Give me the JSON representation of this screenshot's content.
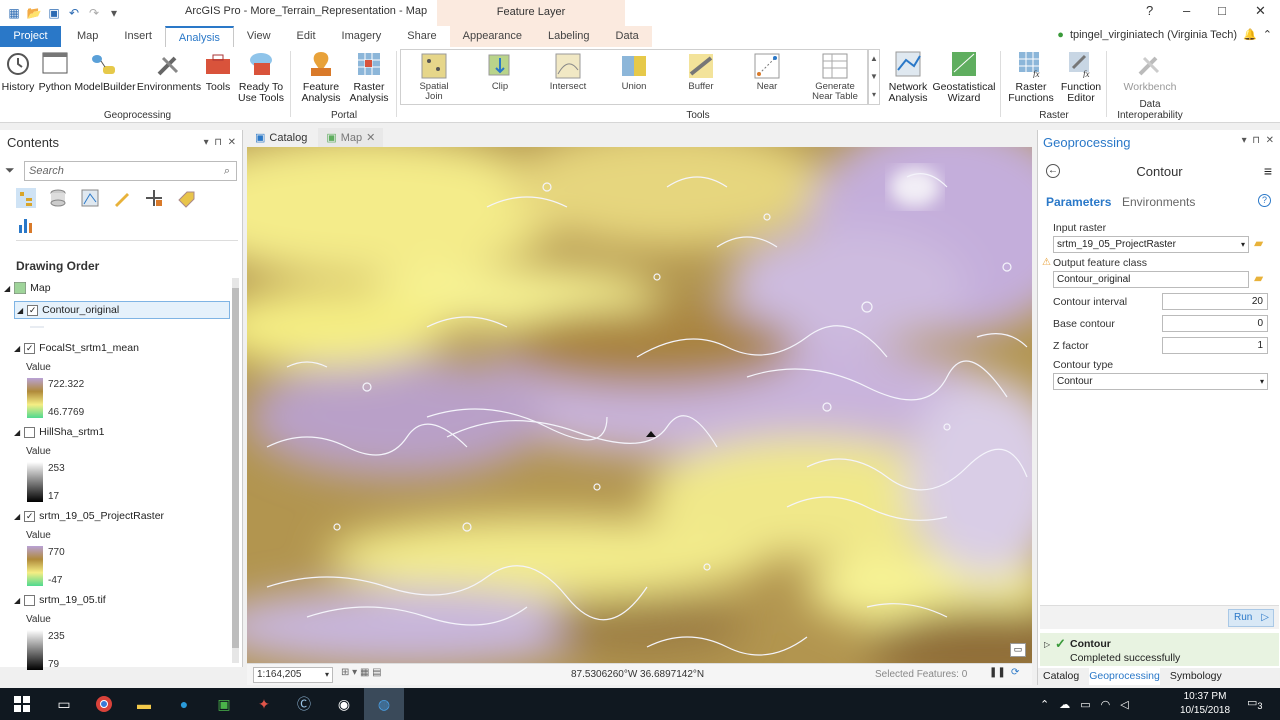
{
  "window": {
    "title": "ArcGIS Pro - More_Terrain_Representation - Map",
    "context_tab": "Feature Layer",
    "help": "?",
    "minimize": "–",
    "maximize": "□",
    "close": "✕"
  },
  "user": {
    "name": "tpingel_virginiatech (Virginia Tech)"
  },
  "tabs": [
    "Project",
    "Map",
    "Insert",
    "Analysis",
    "View",
    "Edit",
    "Imagery",
    "Share",
    "Appearance",
    "Labeling",
    "Data"
  ],
  "ribbon": {
    "geoprocessing": {
      "label": "Geoprocessing",
      "buttons": [
        "History",
        "Python",
        "ModelBuilder",
        "Environments",
        "Tools"
      ],
      "ready_line1": "Ready To",
      "ready_line2": "Use Tools"
    },
    "portal": {
      "label": "Portal",
      "feature_line1": "Feature",
      "feature_line2": "Analysis",
      "raster_line1": "Raster",
      "raster_line2": "Analysis"
    },
    "tools": {
      "label": "Tools",
      "items": [
        {
          "l1": "Spatial",
          "l2": "Join"
        },
        {
          "l1": "Clip",
          "l2": ""
        },
        {
          "l1": "Intersect",
          "l2": ""
        },
        {
          "l1": "Union",
          "l2": ""
        },
        {
          "l1": "Buffer",
          "l2": ""
        },
        {
          "l1": "Near",
          "l2": ""
        },
        {
          "l1": "Generate",
          "l2": "Near Table"
        }
      ],
      "network_line1": "Network",
      "network_line2": "Analysis",
      "geostat_line1": "Geostatistical",
      "geostat_line2": "Wizard"
    },
    "raster": {
      "label": "Raster",
      "rf_line1": "Raster",
      "rf_line2": "Functions",
      "fe_line1": "Function",
      "fe_line2": "Editor"
    },
    "interop": {
      "label": "Data Interoperability",
      "workbench": "Workbench"
    }
  },
  "contents": {
    "title": "Contents",
    "search_placeholder": "Search",
    "drawing_order": "Drawing Order",
    "map_label": "Map",
    "layers": [
      {
        "name": "Contour_original",
        "checked": "✓"
      },
      {
        "name": "FocalSt_srtm1_mean",
        "checked": "✓",
        "value_label": "Value",
        "max": "722.322",
        "min": "46.7769"
      },
      {
        "name": "HillSha_srtm1",
        "checked": "",
        "value_label": "Value",
        "max": "253",
        "min": "17"
      },
      {
        "name": "srtm_19_05_ProjectRaster",
        "checked": "✓",
        "value_label": "Value",
        "max": "770",
        "min": "-47"
      },
      {
        "name": "srtm_19_05.tif",
        "checked": "",
        "value_label": "Value",
        "max": "235",
        "min": "79"
      }
    ]
  },
  "view_tabs": [
    "Catalog",
    "Map"
  ],
  "map_status": {
    "scale": "1:164,205",
    "coords": "87.5306260°W 36.6897142°N",
    "selected": "Selected Features: 0"
  },
  "geoprocessing": {
    "panel_title": "Geoprocessing",
    "tool_name": "Contour",
    "tab_parameters": "Parameters",
    "tab_environments": "Environments",
    "input_raster_label": "Input raster",
    "input_raster_value": "srtm_19_05_ProjectRaster",
    "output_label": "Output feature class",
    "output_value": "Contour_original",
    "interval_label": "Contour interval",
    "interval_value": "20",
    "base_label": "Base contour",
    "base_value": "0",
    "zfactor_label": "Z factor",
    "zfactor_value": "1",
    "type_label": "Contour type",
    "type_value": "Contour",
    "run_label": "Run",
    "result_tool": "Contour",
    "result_status": "Completed successfully",
    "bottom_tabs": [
      "Catalog",
      "Geoprocessing",
      "Symbology"
    ]
  },
  "taskbar": {
    "time": "10:37 PM",
    "date": "10/15/2018",
    "notifications": "3"
  }
}
